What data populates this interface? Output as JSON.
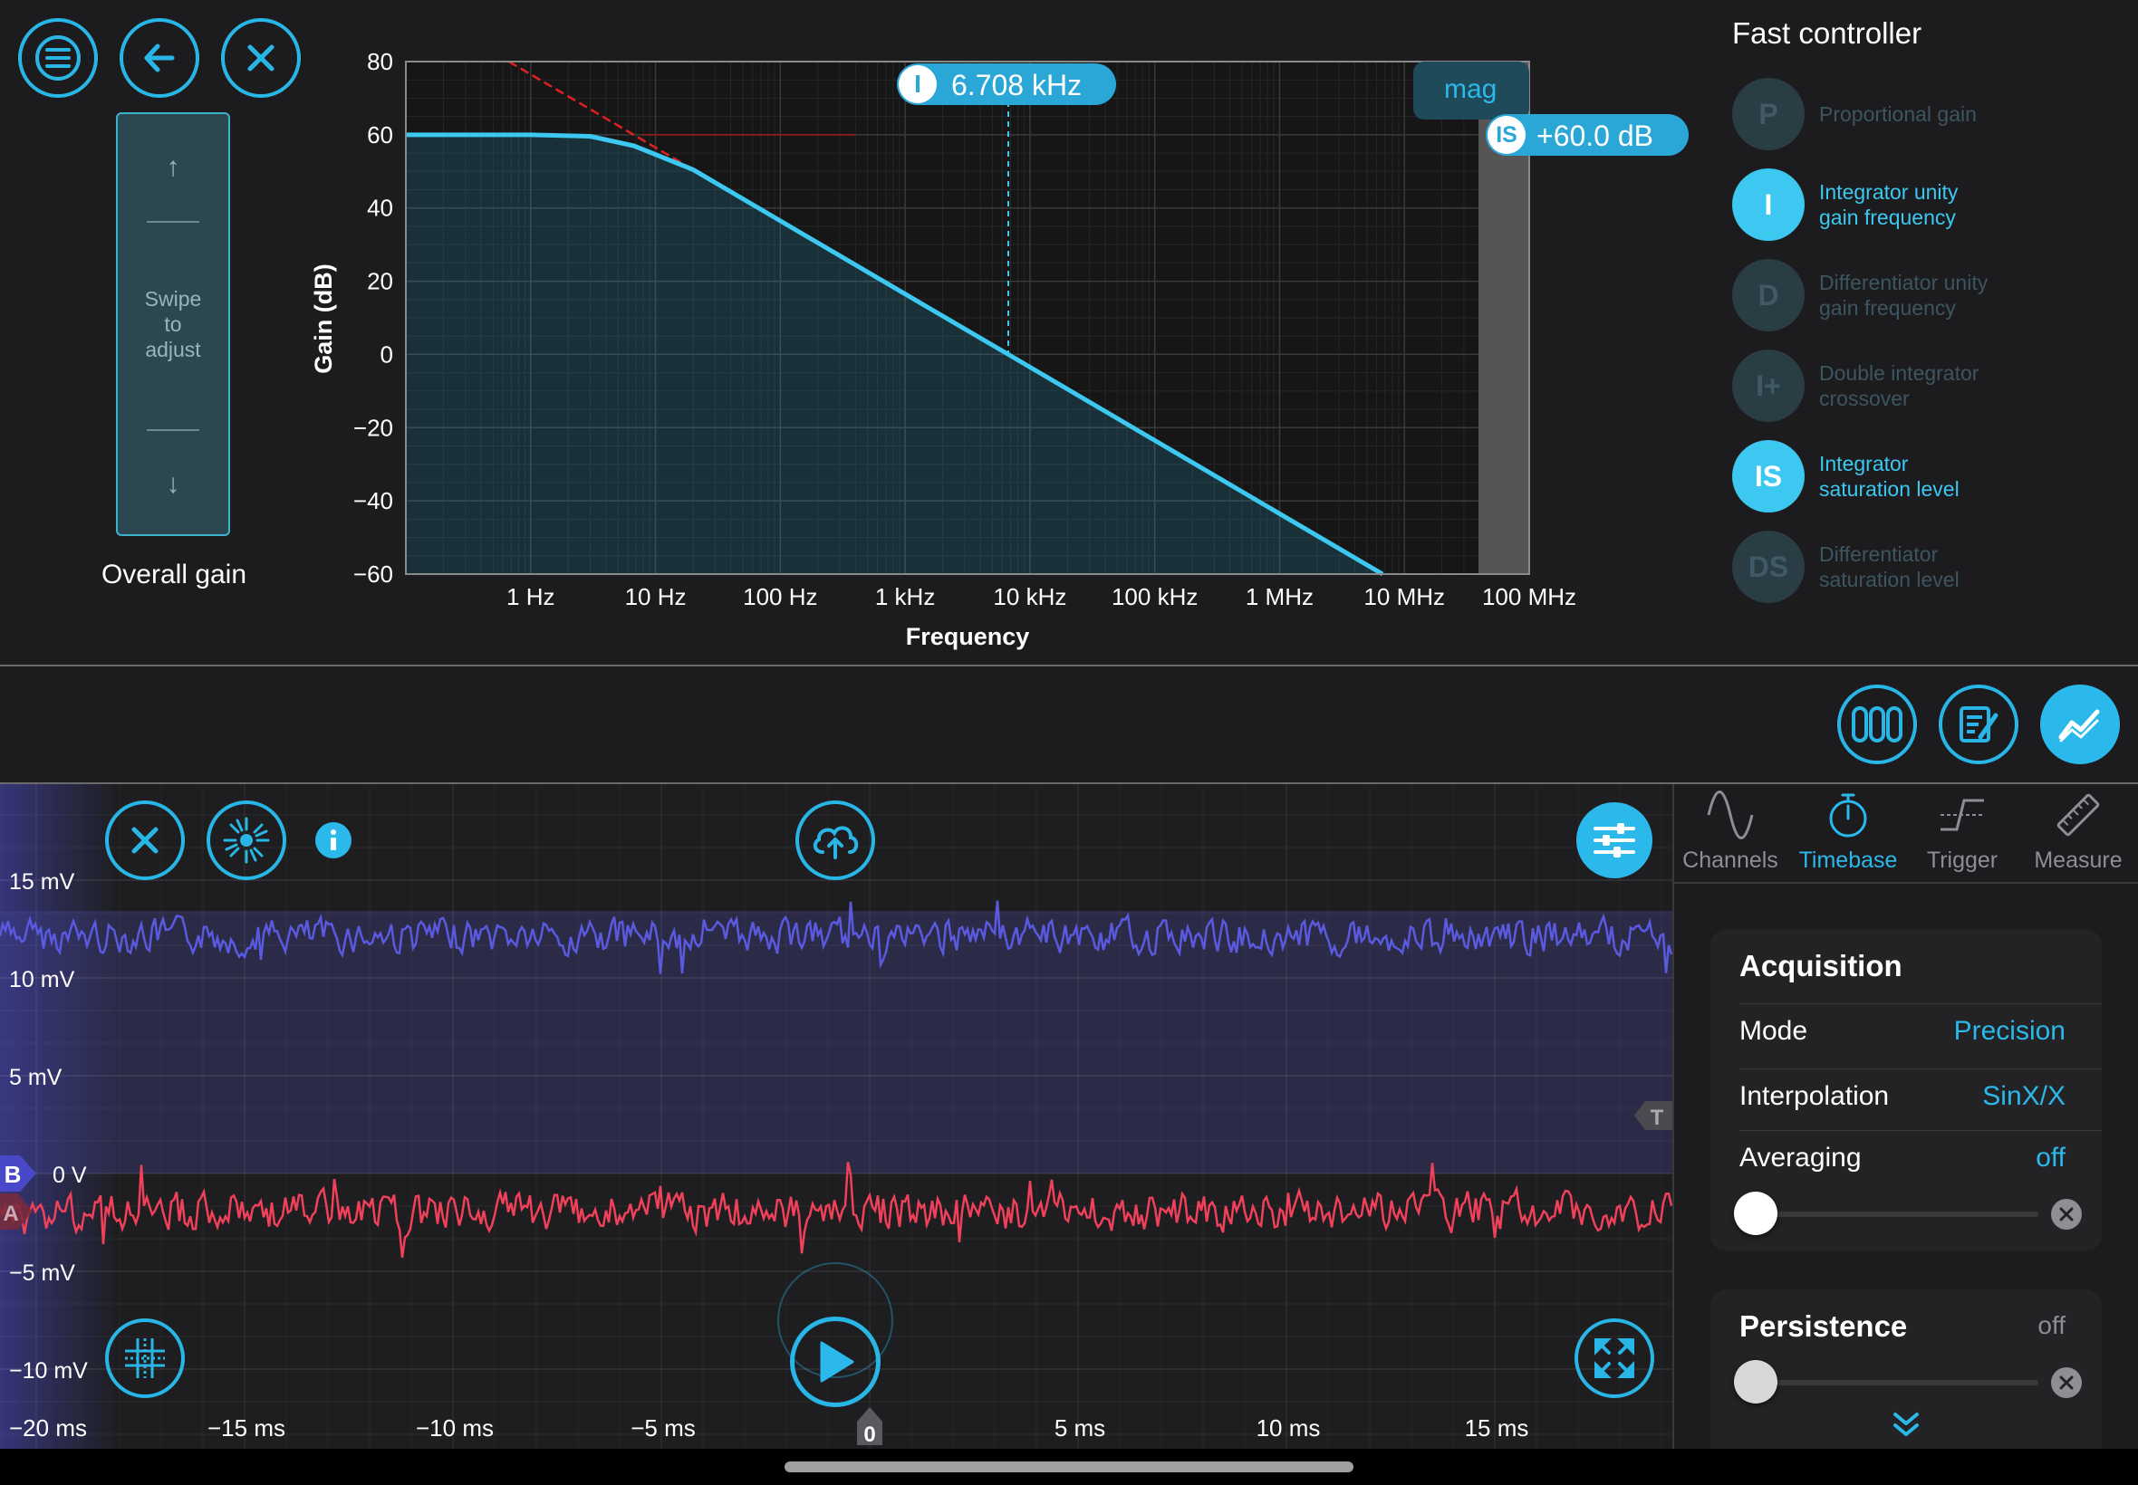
{
  "colors": {
    "accent": "#2bb8ea",
    "background": "#1c1c1e",
    "channel_a": "#f0405a",
    "channel_b": "#5a5ae0",
    "asymptote": "#e02020",
    "inactive": "#3f4a52"
  },
  "top_left": {
    "menu_icon": "hamburger-icon",
    "back_icon": "arrow-left-icon",
    "close_icon": "close-icon",
    "swipe_up": "↑",
    "swipe_label": "Swipe\nto\nadjust",
    "swipe_down": "↓",
    "overall_gain_label": "Overall gain"
  },
  "bode": {
    "cursor_badge": "I",
    "cursor_value": "6.708 kHz",
    "mag_label": "mag",
    "sat_badge": "IS",
    "sat_value": "+60.0 dB"
  },
  "chart_data": {
    "type": "line",
    "xlabel": "Frequency",
    "ylabel": "Gain (dB)",
    "x_scale": "log",
    "xlim_hz": [
      0.1,
      100000000
    ],
    "ylim": [
      -60,
      80
    ],
    "yticks": [
      80,
      60,
      40,
      20,
      0,
      -20,
      -40,
      -60
    ],
    "ytick_labels": [
      "80",
      "60",
      "40",
      "20",
      "0",
      "−20",
      "−40",
      "−60"
    ],
    "xtick_labels": [
      "1 Hz",
      "10 Hz",
      "100 Hz",
      "1 kHz",
      "10 kHz",
      "100 kHz",
      "1 MHz",
      "10 MHz",
      "100 MHz"
    ],
    "grid": true,
    "series": [
      {
        "x_hz": [
          0.1,
          1,
          3,
          6.7,
          20,
          100,
          1000,
          6708,
          100000,
          1000000,
          10000000
        ],
        "y_db": [
          60,
          60,
          59.6,
          57,
          50.5,
          36.5,
          16.5,
          0,
          -23.5,
          -43.5,
          -63.5
        ]
      }
    ],
    "asymptote_hz": [
      0.1,
      67
    ],
    "asymptote_db": [
      96.5,
      40
    ],
    "saturation_level_db": 60,
    "cursor_hz": 6708
  },
  "fast_controller": {
    "title": "Fast controller",
    "items": [
      {
        "badge": "P",
        "label": "Proportional gain",
        "active": false
      },
      {
        "badge": "I",
        "label": "Integrator unity\ngain frequency",
        "active": true
      },
      {
        "badge": "D",
        "label": "Differentiator unity\ngain frequency",
        "active": false
      },
      {
        "badge": "I+",
        "label": "Double integrator\ncrossover",
        "active": false
      },
      {
        "badge": "IS",
        "label": "Integrator\nsaturation level",
        "active": true
      },
      {
        "badge": "DS",
        "label": "Differentiator\nsaturation level",
        "active": false
      }
    ]
  },
  "mid_toolbar": {
    "icons": [
      "register-icon",
      "notes-edit-icon",
      "line-chart-icon"
    ]
  },
  "scope": {
    "y_labels": [
      "15 mV",
      "10 mV",
      "5 mV",
      "0 V",
      "−5 mV",
      "−10 mV"
    ],
    "x_labels": [
      "−20 ms",
      "−15 ms",
      "−10 ms",
      "−5 ms",
      "0",
      "5 ms",
      "10 ms",
      "15 ms"
    ],
    "marker_b": "B",
    "marker_a": "A",
    "trigger_marker": "T",
    "icons": [
      "close-icon",
      "laser-burst-icon",
      "info-icon",
      "cloud-upload-icon",
      "sliders-icon",
      "grid-cursor-icon",
      "play-icon",
      "expand-icon"
    ]
  },
  "right_panel": {
    "tabs": [
      {
        "label": "Channels",
        "icon": "sine-wave-icon",
        "active": false
      },
      {
        "label": "Timebase",
        "icon": "stopwatch-icon",
        "active": true
      },
      {
        "label": "Trigger",
        "icon": "trigger-edge-icon",
        "active": false
      },
      {
        "label": "Measure",
        "icon": "ruler-icon",
        "active": false
      }
    ],
    "acquisition": {
      "title": "Acquisition",
      "mode_label": "Mode",
      "mode_value": "Precision",
      "interp_label": "Interpolation",
      "interp_value": "SinX/X",
      "avg_label": "Averaging",
      "avg_value": "off",
      "avg_slider_level": 0
    },
    "persistence": {
      "title": "Persistence",
      "value": "off",
      "slider_level": 0
    },
    "more_icon": "chevron-double-down-icon"
  }
}
